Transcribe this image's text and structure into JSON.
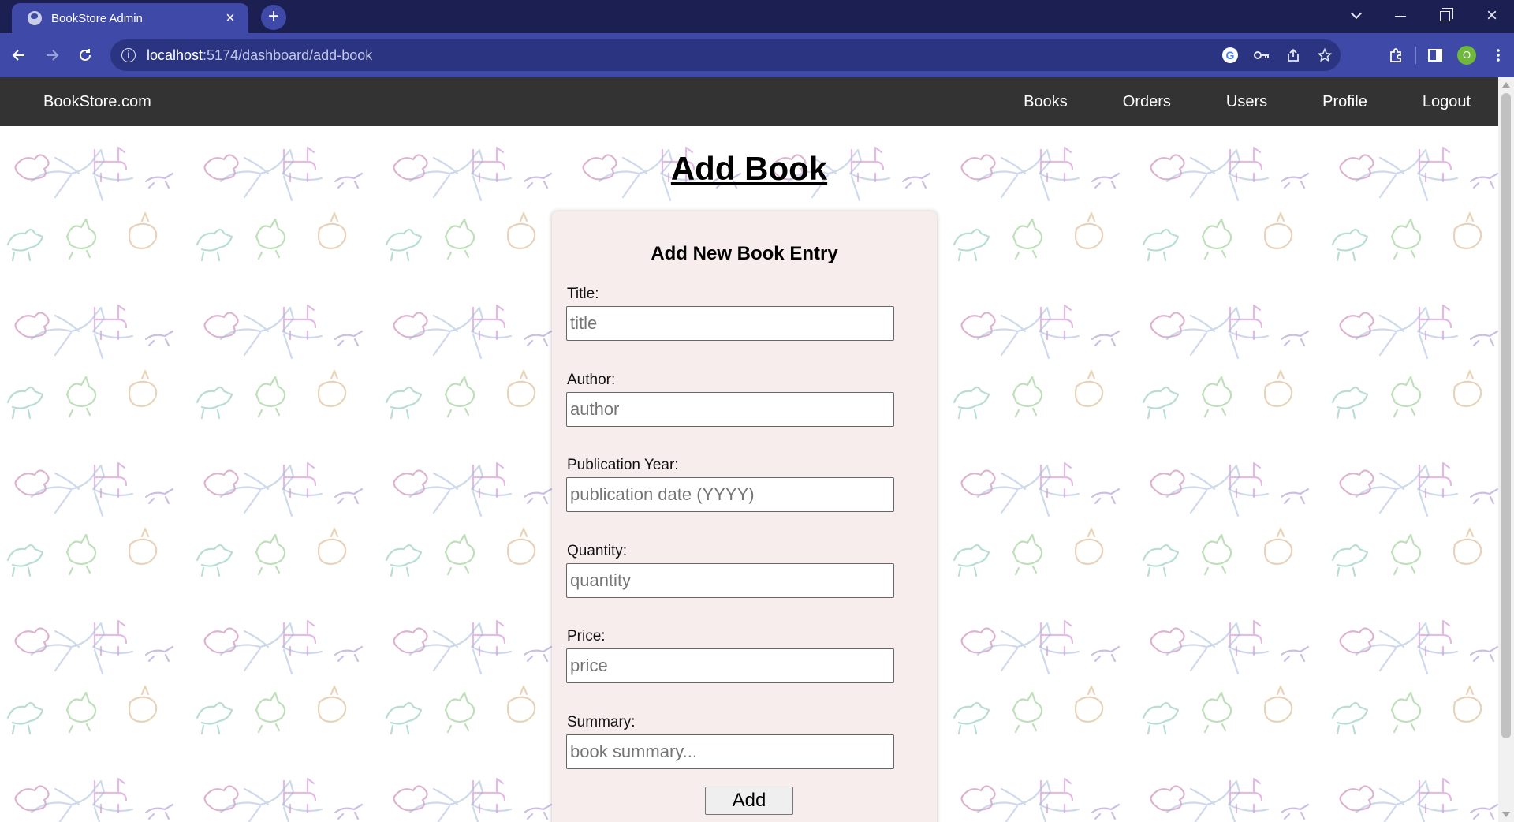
{
  "browser": {
    "tab_title": "BookStore Admin",
    "tab_close": "×",
    "new_tab": "+",
    "url_host": "localhost",
    "url_path": ":5174/dashboard/add-book",
    "profile_initial": "O"
  },
  "site": {
    "brand": "BookStore.com",
    "nav": [
      "Books",
      "Orders",
      "Users",
      "Profile",
      "Logout"
    ]
  },
  "page": {
    "title": "Add Book"
  },
  "form": {
    "heading": "Add New Book Entry",
    "fields": [
      {
        "label": "Title:",
        "placeholder": "title",
        "value": ""
      },
      {
        "label": "Author:",
        "placeholder": "author",
        "value": ""
      },
      {
        "label": "Publication Year:",
        "placeholder": "publication date (YYYY)",
        "value": ""
      },
      {
        "label": "Quantity:",
        "placeholder": "quantity",
        "value": ""
      },
      {
        "label": "Price:",
        "placeholder": "price",
        "value": ""
      },
      {
        "label": "Summary:",
        "placeholder": "book summary...",
        "value": ""
      }
    ],
    "submit_label": "Add"
  },
  "colors": {
    "tab_strip": "#1c1f52",
    "toolbar": "#3f4aa8",
    "site_nav": "#333333",
    "card_bg": "#f7eded"
  }
}
